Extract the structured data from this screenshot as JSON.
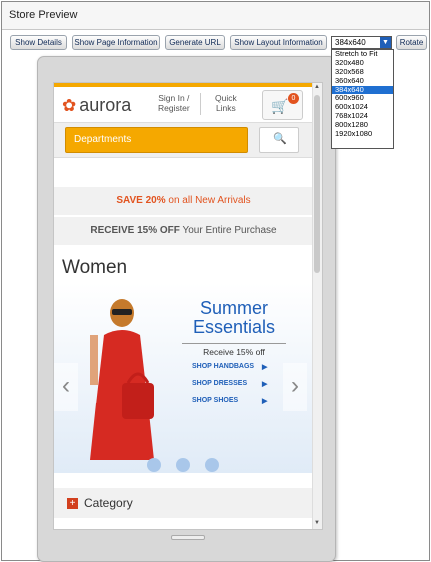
{
  "window": {
    "title": "Store Preview"
  },
  "toolbar": {
    "show_details": "Show Details",
    "show_page_information": "Show Page Information",
    "generate_url": "Generate URL",
    "show_layout_information": "Show Layout Information",
    "rotate": "Rotate"
  },
  "resolution_select": {
    "selected": "384x640",
    "options": [
      "Stretch to Fit",
      "320x480",
      "320x568",
      "360x640",
      "384x640",
      "600x960",
      "600x1024",
      "768x1024",
      "800x1280",
      "1920x1080"
    ]
  },
  "store": {
    "logo_text": "aurora",
    "sign_in_line1": "Sign In /",
    "sign_in_line2": "Register",
    "quick_links_line1": "Quick",
    "quick_links_line2": "Links",
    "cart_count": "0",
    "departments": "Departments",
    "promo1_bold": "SAVE 20%",
    "promo1_rest": " on all New Arrivals",
    "promo2_bold": "RECEIVE 15% OFF",
    "promo2_rest": " Your Entire Purchase",
    "section_title": "Women",
    "banner": {
      "headline1": "Summer",
      "headline2": "Essentials",
      "subhead": "Receive 15% off",
      "links": [
        "SHOP HANDBAGS",
        "SHOP DRESSES",
        "SHOP SHOES"
      ]
    },
    "category_label": "Category"
  },
  "colors": {
    "accent_orange": "#f5a800",
    "brand_red": "#e2531f",
    "link_blue": "#1f5fb8"
  }
}
